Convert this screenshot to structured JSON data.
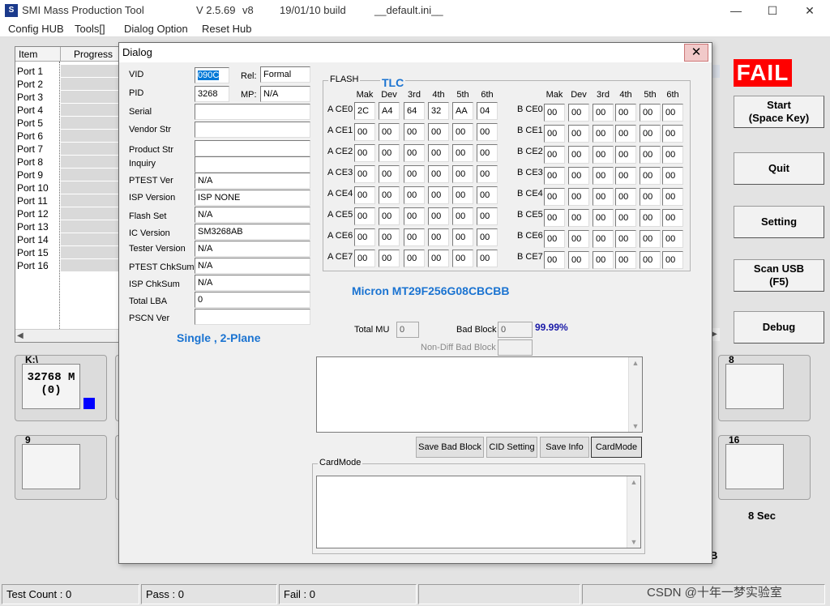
{
  "window": {
    "app_name": "SMI Mass Production Tool",
    "version": "V 2.5.69",
    "variant": "v8",
    "build": "19/01/10 build",
    "ini_file": "__default.ini__"
  },
  "menu": [
    "Config HUB",
    "Tools[]",
    "Dialog Option",
    "Reset Hub"
  ],
  "port_list": {
    "col_item": "Item",
    "col_progress": "Progress",
    "ports": [
      "Port 1",
      "Port 2",
      "Port 3",
      "Port 4",
      "Port 5",
      "Port 6",
      "Port 7",
      "Port 8",
      "Port 9",
      "Port 10",
      "Port 11",
      "Port 12",
      "Port 13",
      "Port 14",
      "Port 15",
      "Port 16"
    ]
  },
  "port_boxes": {
    "box1_label": "K:\\",
    "box1_capacity": "32768 M",
    "box1_count": "(0)",
    "box9_label": "9",
    "box8_label": "8",
    "box16_label": "16"
  },
  "side": {
    "fail": "FAIL",
    "start": "Start\n(Space Key)",
    "quit": "Quit",
    "setting": "Setting",
    "scan": "Scan USB\n(F5)",
    "debug": "Debug",
    "timer": "8 Sec",
    "b_letter": "B"
  },
  "status": {
    "test_count": "Test Count : 0",
    "pass": "Pass : 0",
    "fail": "Fail : 0",
    "watermark": "CSDN @十年一梦实验室"
  },
  "dialog": {
    "title": "Dialog",
    "close": "✕",
    "fields": {
      "vid_label": "VID",
      "vid": "090C",
      "rel_label": "Rel:",
      "rel": "Formal",
      "pid_label": "PID",
      "pid": "3268",
      "mp_label": "MP:",
      "mp": "N/A",
      "serial_label": "Serial",
      "serial": "",
      "vendor_label": "Vendor Str",
      "vendor": "",
      "product_label": "Product Str",
      "product": "",
      "inquiry_label": "Inquiry",
      "inquiry": "",
      "ptest_label": "PTEST Ver",
      "ptest": "N/A",
      "isp_label": "ISP Version",
      "isp": "ISP NONE",
      "flashset_label": "Flash Set",
      "flashset": "N/A",
      "ic_label": "IC Version",
      "ic": "SM3268AB",
      "tester_label": "Tester Version",
      "tester": "N/A",
      "ptestchk_label": "PTEST ChkSum",
      "ptestchk": "N/A",
      "ispchk_label": "ISP ChkSum",
      "ispchk": "N/A",
      "lba_label": "Total LBA",
      "lba": "0",
      "pscn_label": "PSCN Ver",
      "pscn": ""
    },
    "mode": "Single , 2-Plane",
    "flash": {
      "group_title": "FLASH",
      "type": "TLC",
      "col_headers": [
        "Mak",
        "Dev",
        "3rd",
        "4th",
        "5th",
        "6th"
      ],
      "a_rows": [
        {
          "label": "A CE0",
          "values": [
            "2C",
            "A4",
            "64",
            "32",
            "AA",
            "04"
          ]
        },
        {
          "label": "A CE1",
          "values": [
            "00",
            "00",
            "00",
            "00",
            "00",
            "00"
          ]
        },
        {
          "label": "A CE2",
          "values": [
            "00",
            "00",
            "00",
            "00",
            "00",
            "00"
          ]
        },
        {
          "label": "A CE3",
          "values": [
            "00",
            "00",
            "00",
            "00",
            "00",
            "00"
          ]
        },
        {
          "label": "A CE4",
          "values": [
            "00",
            "00",
            "00",
            "00",
            "00",
            "00"
          ]
        },
        {
          "label": "A CE5",
          "values": [
            "00",
            "00",
            "00",
            "00",
            "00",
            "00"
          ]
        },
        {
          "label": "A CE6",
          "values": [
            "00",
            "00",
            "00",
            "00",
            "00",
            "00"
          ]
        },
        {
          "label": "A CE7",
          "values": [
            "00",
            "00",
            "00",
            "00",
            "00",
            "00"
          ]
        }
      ],
      "b_rows": [
        {
          "label": "B CE0",
          "values": [
            "00",
            "00",
            "00",
            "00",
            "00",
            "00"
          ]
        },
        {
          "label": "B CE1",
          "values": [
            "00",
            "00",
            "00",
            "00",
            "00",
            "00"
          ]
        },
        {
          "label": "B CE2",
          "values": [
            "00",
            "00",
            "00",
            "00",
            "00",
            "00"
          ]
        },
        {
          "label": "B CE3",
          "values": [
            "00",
            "00",
            "00",
            "00",
            "00",
            "00"
          ]
        },
        {
          "label": "B CE4",
          "values": [
            "00",
            "00",
            "00",
            "00",
            "00",
            "00"
          ]
        },
        {
          "label": "B CE5",
          "values": [
            "00",
            "00",
            "00",
            "00",
            "00",
            "00"
          ]
        },
        {
          "label": "B CE6",
          "values": [
            "00",
            "00",
            "00",
            "00",
            "00",
            "00"
          ]
        },
        {
          "label": "B CE7",
          "values": [
            "00",
            "00",
            "00",
            "00",
            "00",
            "00"
          ]
        }
      ]
    },
    "part_number": "Micron MT29F256G08CBCBB",
    "total_mu_label": "Total MU",
    "total_mu": "0",
    "bad_block_label": "Bad Block",
    "bad_block": "0",
    "bad_block_pct": "99.99%",
    "nondiff_label": "Non-Diff Bad Block",
    "nondiff": "",
    "buttons": [
      "Save Bad Block",
      "CID Setting",
      "Save Info",
      "CardMode"
    ],
    "cardmode_title": "CardMode"
  }
}
